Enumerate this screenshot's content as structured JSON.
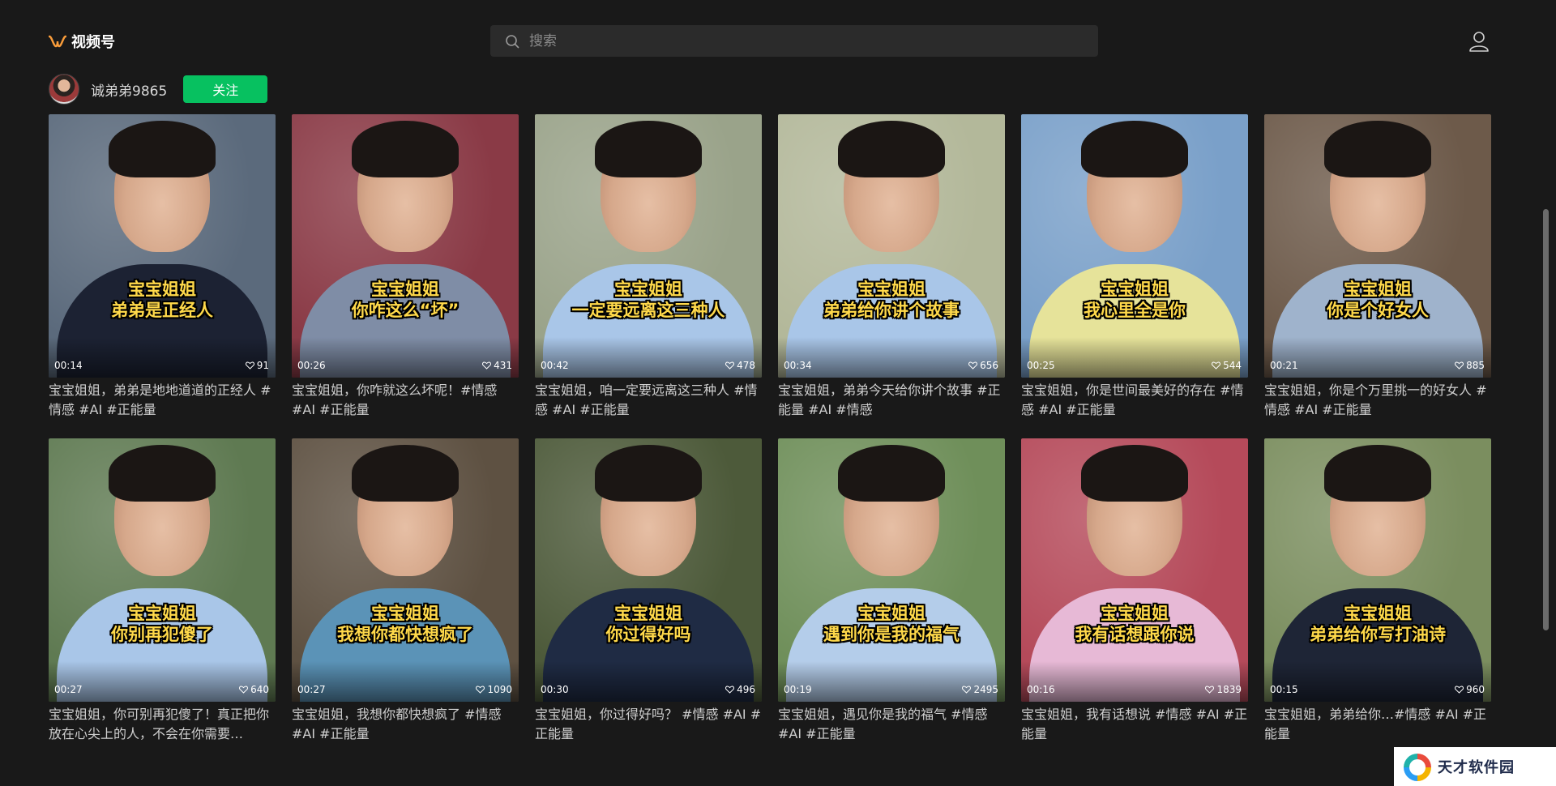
{
  "header": {
    "app_name": "视频号",
    "search_placeholder": "搜索"
  },
  "author": {
    "name": "诚弟弟9865",
    "follow_label": "关注"
  },
  "videos": [
    {
      "caption_line1": "宝宝姐姐",
      "caption_line2": "弟弟是正经人",
      "duration": "00:14",
      "likes": "91",
      "desc": "宝宝姐姐，弟弟是地地道道的正经人 #情感 #AI #正能量",
      "bg": "#5b6a7c",
      "shirt": "#1c2233"
    },
    {
      "caption_line1": "宝宝姐姐",
      "caption_line2": "你咋这么“坏”",
      "duration": "00:26",
      "likes": "431",
      "desc": "宝宝姐姐，你咋就这么坏呢！#情感 #AI #正能量",
      "bg": "#8a3a46",
      "shirt": "#7f8da6"
    },
    {
      "caption_line1": "宝宝姐姐",
      "caption_line2": "一定要远离这三种人",
      "duration": "00:42",
      "likes": "478",
      "desc": "宝宝姐姐，咱一定要远离这三种人 #情感 #AI #正能量",
      "bg": "#9aa38a",
      "shirt": "#a9c6e8"
    },
    {
      "caption_line1": "宝宝姐姐",
      "caption_line2": "弟弟给你讲个故事",
      "duration": "00:34",
      "likes": "656",
      "desc": "宝宝姐姐，弟弟今天给你讲个故事 #正能量 #AI #情感",
      "bg": "#b3b89a",
      "shirt": "#a9c6e8"
    },
    {
      "caption_line1": "宝宝姐姐",
      "caption_line2": "我心里全是你",
      "duration": "00:25",
      "likes": "544",
      "desc": "宝宝姐姐，你是世间最美好的存在 #情感 #AI #正能量",
      "bg": "#7aa0c9",
      "shirt": "#e6e39a"
    },
    {
      "caption_line1": "宝宝姐姐",
      "caption_line2": "你是个好女人",
      "duration": "00:21",
      "likes": "885",
      "desc": "宝宝姐姐，你是个万里挑一的好女人 #情感 #AI #正能量",
      "bg": "#6d5a4a",
      "shirt": "#9fb3cc"
    },
    {
      "caption_line1": "宝宝姐姐",
      "caption_line2": "你别再犯傻了",
      "duration": "00:27",
      "likes": "640",
      "desc": "宝宝姐姐，你可别再犯傻了！真正把你放在心尖上的人，不会在你需要…",
      "bg": "#5f7a52",
      "shirt": "#a9c6e8"
    },
    {
      "caption_line1": "宝宝姐姐",
      "caption_line2": "我想你都快想疯了",
      "duration": "00:27",
      "likes": "1090",
      "desc": "宝宝姐姐，我想你都快想疯了 #情感 #AI #正能量",
      "bg": "#5e5142",
      "shirt": "#5b93b7"
    },
    {
      "caption_line1": "宝宝姐姐",
      "caption_line2": "你过得好吗",
      "duration": "00:30",
      "likes": "496",
      "desc": "宝宝姐姐，你过得好吗？ #情感 #AI #正能量",
      "bg": "#4d5a3a",
      "shirt": "#1f2b44"
    },
    {
      "caption_line1": "宝宝姐姐",
      "caption_line2": "遇到你是我的福气",
      "duration": "00:19",
      "likes": "2495",
      "desc": "宝宝姐姐，遇见你是我的福气 #情感 #AI #正能量",
      "bg": "#6f8f5a",
      "shirt": "#b4cdea"
    },
    {
      "caption_line1": "宝宝姐姐",
      "caption_line2": "我有话想跟你说",
      "duration": "00:16",
      "likes": "1839",
      "desc": "宝宝姐姐，我有话想说 #情感 #AI #正能量",
      "bg": "#b54a5a",
      "shirt": "#e7b9d6"
    },
    {
      "caption_line1": "宝宝姐姐",
      "caption_line2": "弟弟给你写打油诗",
      "duration": "00:15",
      "likes": "960",
      "desc": "宝宝姐姐，弟弟给你…#情感 #AI #正能量",
      "bg": "#7b8e5f",
      "shirt": "#1e2536"
    }
  ],
  "watermark": {
    "text": "天才软件园"
  }
}
